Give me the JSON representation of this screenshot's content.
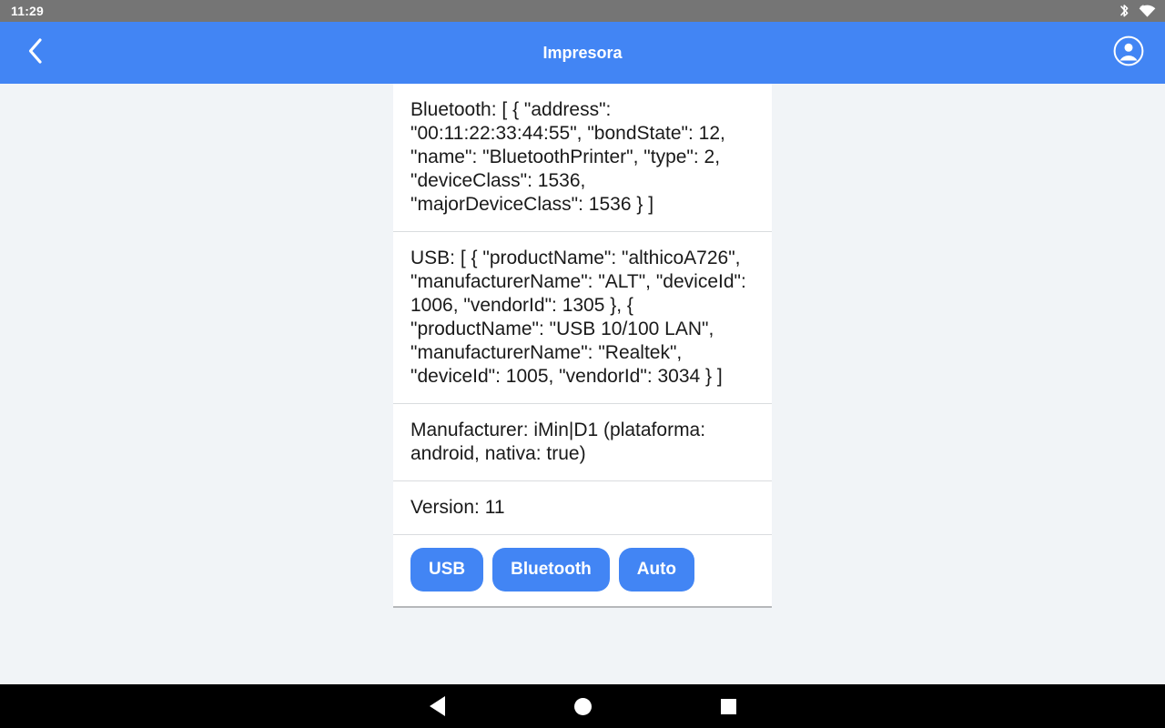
{
  "status_bar": {
    "clock": "11:29",
    "icons": [
      "bluetooth-icon",
      "wifi-icon"
    ],
    "background_color": "#757575"
  },
  "app_bar": {
    "title": "Impresora",
    "back_icon": "chevron-left-icon",
    "account_icon": "account-circle-icon",
    "background_color": "#4285f4",
    "title_color": "#ffffff"
  },
  "card": {
    "background_color": "#ffffff",
    "sections": [
      {
        "name": "bluetooth-info",
        "text": "Bluetooth: [ { \"address\": \"00:11:22:33:44:55\", \"bondState\": 12, \"name\": \"BluetoothPrinter\", \"type\": 2, \"deviceClass\": 1536, \"majorDeviceClass\": 1536 } ]"
      },
      {
        "name": "usb-info",
        "text": "USB: [ { \"productName\": \"althicoA726\", \"manufacturerName\": \"ALT\", \"deviceId\": 1006, \"vendorId\": 1305 }, { \"productName\": \"USB 10/100 LAN\", \"manufacturerName\": \"Realtek\", \"deviceId\": 1005, \"vendorId\": 3034 } ]"
      },
      {
        "name": "manufacturer-info",
        "text": "Manufacturer: iMin|D1 (plataforma: android, nativa: true)"
      },
      {
        "name": "version-info",
        "text": "Version: 11"
      }
    ],
    "buttons": [
      {
        "name": "usb-button",
        "label": "USB"
      },
      {
        "name": "bluetooth-button",
        "label": "Bluetooth"
      },
      {
        "name": "auto-button",
        "label": "Auto"
      }
    ],
    "button_color": "#4285f4"
  },
  "nav_bar": {
    "background_color": "#000000",
    "items": [
      {
        "name": "nav-back-button",
        "icon": "triangle-back-icon"
      },
      {
        "name": "nav-home-button",
        "icon": "circle-home-icon"
      },
      {
        "name": "nav-recents-button",
        "icon": "square-recents-icon"
      }
    ]
  },
  "page": {
    "background_color": "#f1f4f7"
  }
}
